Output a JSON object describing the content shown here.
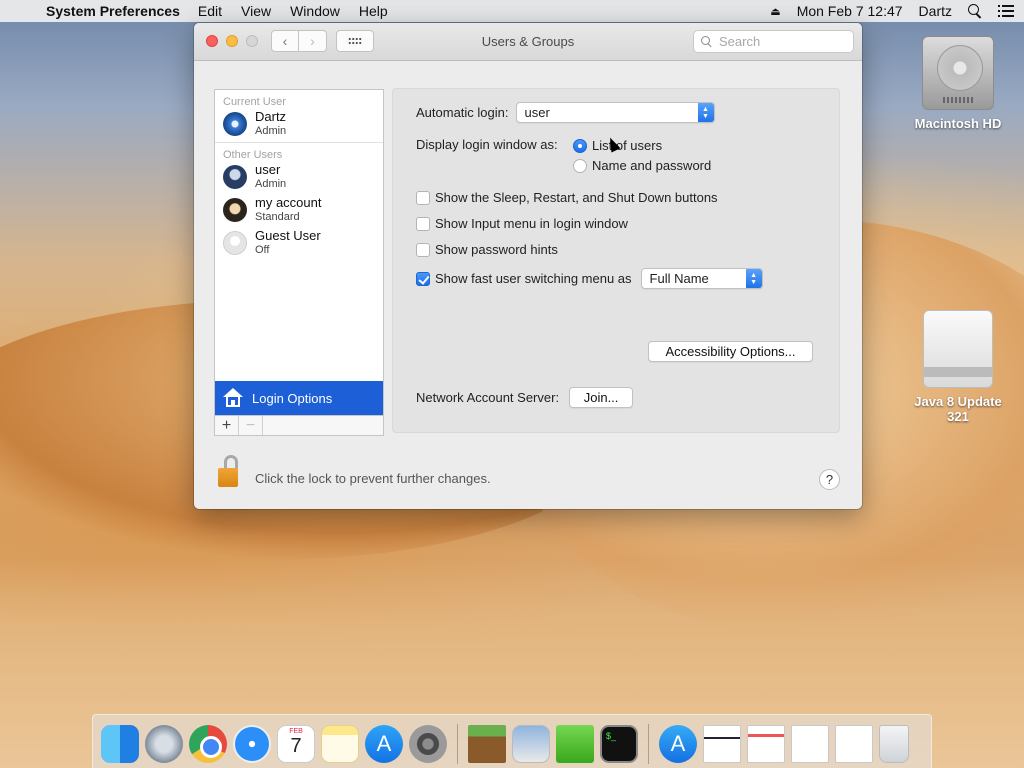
{
  "menubar": {
    "app_name": "System Preferences",
    "menus": [
      "Edit",
      "View",
      "Window",
      "Help"
    ],
    "clock": "Mon Feb 7  12:47",
    "user": "Dartz"
  },
  "window": {
    "title": "Users & Groups",
    "search_placeholder": "Search"
  },
  "users": {
    "current_header": "Current User",
    "other_header": "Other Users",
    "current": [
      {
        "name": "Dartz",
        "role": "Admin",
        "avatar": "blue-flower"
      }
    ],
    "others": [
      {
        "name": "user",
        "role": "Admin",
        "avatar": "dark-portrait"
      },
      {
        "name": "my account",
        "role": "Standard",
        "avatar": "face-portrait"
      },
      {
        "name": "Guest User",
        "role": "Off",
        "avatar": "guest-silhouette"
      }
    ],
    "login_options_label": "Login Options",
    "add_symbol": "+",
    "remove_symbol": "−"
  },
  "login_options": {
    "automatic_login_label": "Automatic login:",
    "automatic_login_value": "user",
    "display_window_label": "Display login window as:",
    "display_choices": [
      {
        "label": "List of users",
        "selected": true
      },
      {
        "label": "Name and password",
        "selected": false
      }
    ],
    "checkboxes": [
      {
        "label": "Show the Sleep, Restart, and Shut Down buttons",
        "checked": false
      },
      {
        "label": "Show Input menu in login window",
        "checked": false
      },
      {
        "label": "Show password hints",
        "checked": false
      },
      {
        "label": "Show fast user switching menu as",
        "checked": true
      }
    ],
    "fast_switch_value": "Full Name",
    "accessibility_button": "Accessibility Options...",
    "network_server_label": "Network Account Server:",
    "join_button": "Join..."
  },
  "footer": {
    "lock_message": "Click the lock to prevent further changes.",
    "help_symbol": "?"
  },
  "desktop": {
    "icons": [
      {
        "label": "Macintosh HD",
        "icon": "hard-drive-icon"
      },
      {
        "label": "Java 8 Update 321",
        "icon": "external-drive-icon"
      }
    ]
  },
  "dock": {
    "calendar_month": "FEB",
    "calendar_day": "7",
    "items": [
      "Finder",
      "Launchpad",
      "Google Chrome",
      "Safari",
      "Calendar",
      "Notes",
      "App Store",
      "System Preferences",
      "Minecraft",
      "Preview",
      "Green App",
      "Terminal",
      "Applications",
      "Document",
      "Document",
      "Document",
      "Document",
      "Trash"
    ]
  },
  "colors": {
    "selection": "#1d5fd6",
    "accent": "#1f73e8",
    "close": "#fc605c",
    "minimize": "#fdbc40"
  }
}
